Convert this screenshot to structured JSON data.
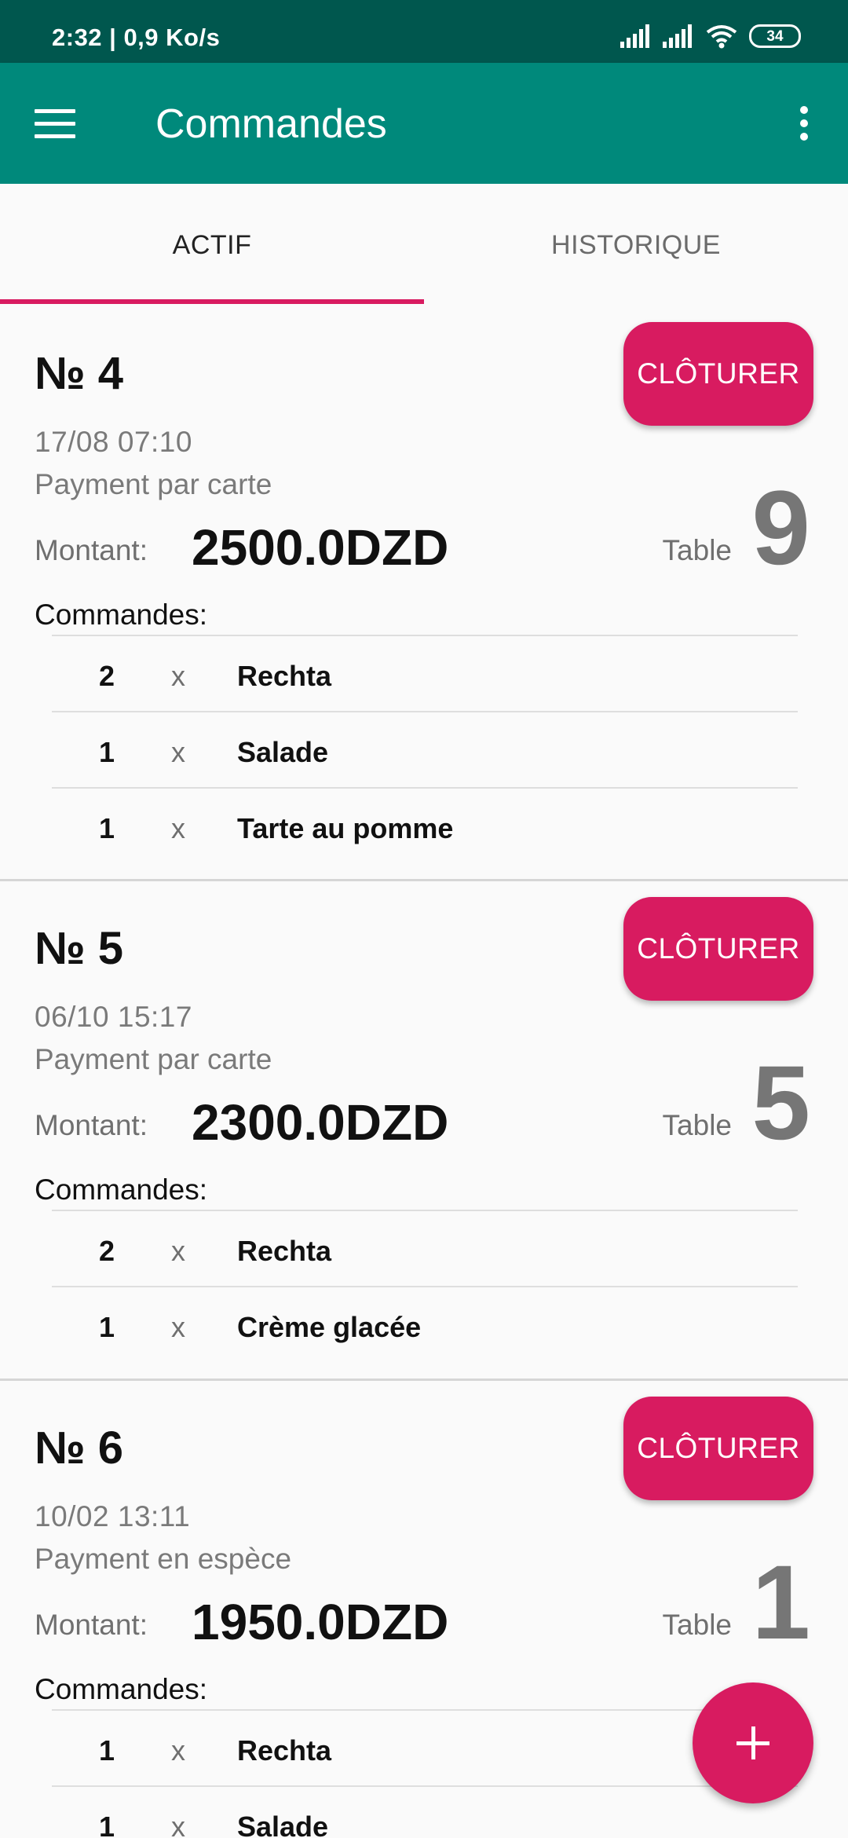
{
  "status": {
    "time": "2:32 | 0,9 Ko/s",
    "battery": "34",
    "icons": [
      "signal-icon",
      "signal-icon",
      "wifi-icon",
      "battery-icon"
    ]
  },
  "appbar": {
    "title": "Commandes",
    "menu_icon": "hamburger-icon",
    "more_icon": "more-vert-icon"
  },
  "tabs": [
    {
      "label": "ACTIF"
    },
    {
      "label": "HISTORIQUE"
    }
  ],
  "labels": {
    "montant": "Montant:",
    "table": "Table",
    "commandes": "Commandes:",
    "close_button": "CLÔTURER"
  },
  "orders": [
    {
      "number": "№ 4",
      "date": "17/08  07:10",
      "payment": "Payment par carte",
      "amount": "2500.0DZD",
      "table": "9",
      "items": [
        {
          "qty": "2",
          "x": "x",
          "name": "Rechta"
        },
        {
          "qty": "1",
          "x": "x",
          "name": "Salade"
        },
        {
          "qty": "1",
          "x": "x",
          "name": "Tarte au pomme"
        }
      ]
    },
    {
      "number": "№ 5",
      "date": "06/10  15:17",
      "payment": "Payment par carte",
      "amount": "2300.0DZD",
      "table": "5",
      "items": [
        {
          "qty": "2",
          "x": "x",
          "name": "Rechta"
        },
        {
          "qty": "1",
          "x": "x",
          "name": "Crème glacée"
        }
      ]
    },
    {
      "number": "№ 6",
      "date": "10/02  13:11",
      "payment": "Payment en espèce",
      "amount": "1950.0DZD",
      "table": "1",
      "items": [
        {
          "qty": "1",
          "x": "x",
          "name": "Rechta"
        },
        {
          "qty": "1",
          "x": "x",
          "name": "Salade"
        }
      ]
    }
  ],
  "fab": {
    "icon": "plus-icon"
  },
  "colors": {
    "statusbar": "#00574e",
    "appbar": "#00897b",
    "accent": "#d81b60",
    "background": "#fafafa"
  }
}
